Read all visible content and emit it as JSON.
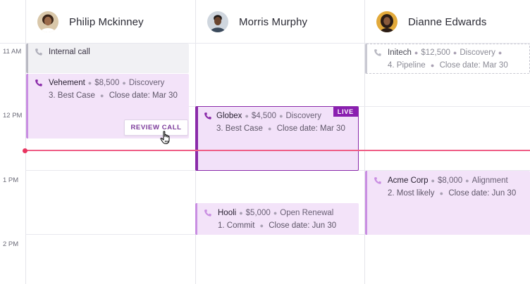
{
  "people": [
    {
      "name": "Philip Mckinney"
    },
    {
      "name": "Morris Murphy"
    },
    {
      "name": "Dianne Edwards"
    }
  ],
  "times": [
    "11 AM",
    "12 PM",
    "1 PM",
    "2 PM"
  ],
  "colors": {
    "accent": "#8a1fb0",
    "event_bg": "#f3e3f9",
    "now_line": "#ef5e86"
  },
  "events": {
    "internal": {
      "title": "Internal call"
    },
    "vehement": {
      "company": "Vehement",
      "amount": "$8,500",
      "stage": "Discovery",
      "forecast": "3. Best Case",
      "close": "Close date: Mar 30",
      "action": "REVIEW CALL"
    },
    "globex": {
      "company": "Globex",
      "amount": "$4,500",
      "stage": "Discovery",
      "forecast": "3. Best Case",
      "close": "Close date: Mar 30",
      "badge": "LIVE"
    },
    "hooli": {
      "company": "Hooli",
      "amount": "$5,000",
      "stage": "Open Renewal",
      "forecast": "1. Commit",
      "close": "Close date: Jun 30"
    },
    "initech": {
      "company": "Initech",
      "amount": "$12,500",
      "stage": "Discovery",
      "forecast": "4. Pipeline",
      "close": "Close date: Mar 30"
    },
    "acme": {
      "company": "Acme Corp",
      "amount": "$8,000",
      "stage": "Alignment",
      "forecast": "2. Most likely",
      "close": "Close date: Jun 30"
    }
  },
  "icons": [
    "phone-icon",
    "cursor-hand-icon"
  ]
}
